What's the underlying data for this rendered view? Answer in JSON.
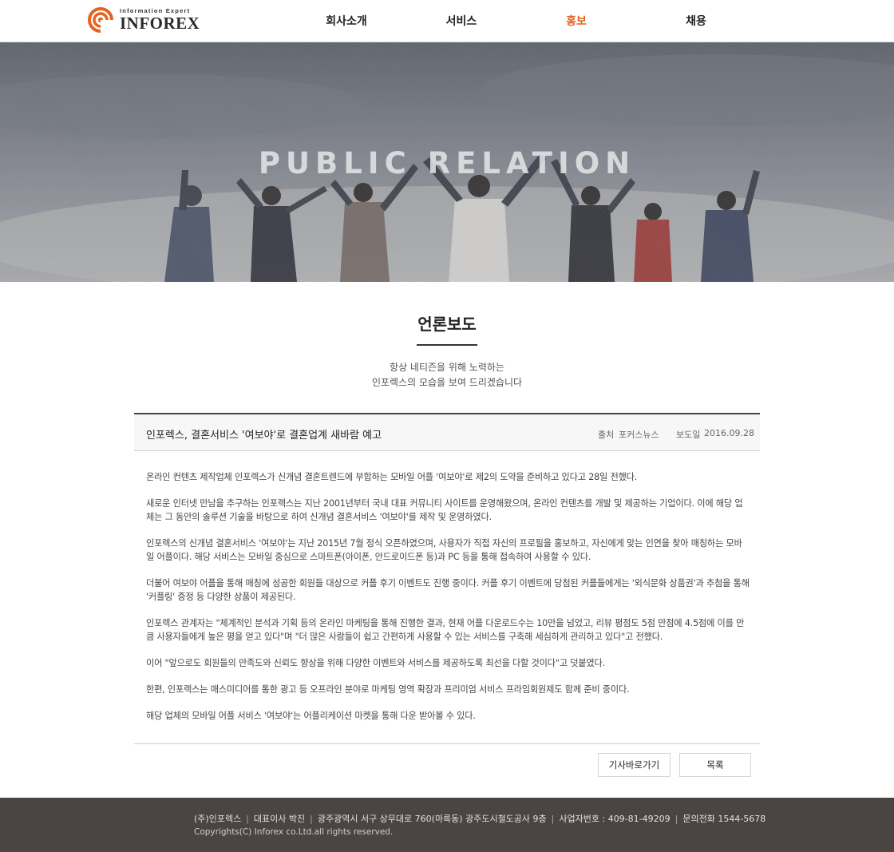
{
  "header": {
    "logo": {
      "tagline": "Information Expert",
      "name": "INFOREX",
      "icon": "signal-rings-icon"
    },
    "nav": [
      {
        "label": "회사소개",
        "active": false
      },
      {
        "label": "서비스",
        "active": false
      },
      {
        "label": "홍보",
        "active": true
      },
      {
        "label": "채용",
        "active": false
      }
    ],
    "accent_color": "#e5631f"
  },
  "hero": {
    "title": "PUBLIC RELATION"
  },
  "section": {
    "title": "언론보도",
    "subtitle_line1": "항상 네티즌을 위해 노력하는",
    "subtitle_line2": "인포렉스의 모습을 보여 드리겠습니다"
  },
  "article": {
    "title": "인포렉스, 결혼서비스 '여보야'로 결혼업계 새바람 예고",
    "source_label": "출처",
    "source": "포커스뉴스",
    "date_label": "보도일",
    "date": "2016.09.28",
    "paragraphs": [
      "온라인 컨텐츠 제작업체 인포렉스가 신개념 결혼트렌드에 부합하는 모바일 어플 '여보야'로 제2의 도약을 준비하고 있다고 28일 전했다.",
      "새로운 인터넷 만남을 추구하는 인포렉스는 지난 2001년부터 국내 대표 커뮤니티 사이트를 운영해왔으며, 온라인 컨텐츠를 개발 및 제공하는 기업이다. 이에 해당 업체는 그 동안의 솔루션 기술을 바탕으로 하여 신개념 결혼서비스 '여보야'를 제작 및 운영하였다.",
      "인포렉스의 신개념 결혼서비스 '여보야'는 지난 2015년 7월 정식 오픈하였으며, 사용자가 직접 자신의 프로필을 홍보하고, 자신에게 맞는 인연을 찾아 매칭하는 모바일 어플이다. 해당 서비스는 모바일 중심으로 스마트폰(아이폰, 안드로이드폰 등)과 PC 등을 통해 접속하여 사용할 수 있다.",
      "더불어 여보야 어플을 통해 매칭에 성공한 회원들 대상으로 커플 후기 이벤트도 진행 중이다. 커플 후기 이벤트에 당첨된 커플들에게는 '외식문화 상품권'과 추첨을 통해 '커플링' 증정 등 다양한 상품이 제공된다.",
      "인포렉스 관계자는 \"체계적인 분석과 기획 등의 온라인 마케팅을 통해 진행한 결과, 현재 어플 다운로드수는 10만을 넘었고, 리뷰 평점도 5점 만점에 4.5점에 이를 만큼 사용자들에게 높은 평을 얻고 있다\"며 \"더 많은 사람들이 쉽고 간편하게 사용할 수 있는 서비스를 구축해 세심하게 관리하고 있다\"고 전했다.",
      "이어 \"앞으로도 회원들의 만족도와 신뢰도 향상을 위해 다양한 이벤트와 서비스를 제공하도록 최선을 다할 것이다\"고 덧붙였다.",
      "한편, 인포렉스는 매스미디어를 통한 광고 등 오프라인 분야로 마케팅 영역 확장과 프리미엄 서비스 프라임회원제도 함께 준비 중이다.",
      "해당 업체의 모바일 어플 서비스 '여보야'는 어플리케이션 마켓을 통해 다운 받아볼 수 있다."
    ]
  },
  "buttons": {
    "go_article": "기사바로가기",
    "list": "목록"
  },
  "footer": {
    "company": "(주)인포렉스",
    "ceo": "대표이사 박진",
    "address": "광주광역시 서구 상무대로 760(마륵동) 광주도시철도공사 9층",
    "business_no": "사업자번호 : 409-81-49209",
    "phone": "문의전화 1544-5678",
    "separator": "|",
    "copyright": "Copyrights(C) Inforex co.Ltd.all rights reserved."
  }
}
